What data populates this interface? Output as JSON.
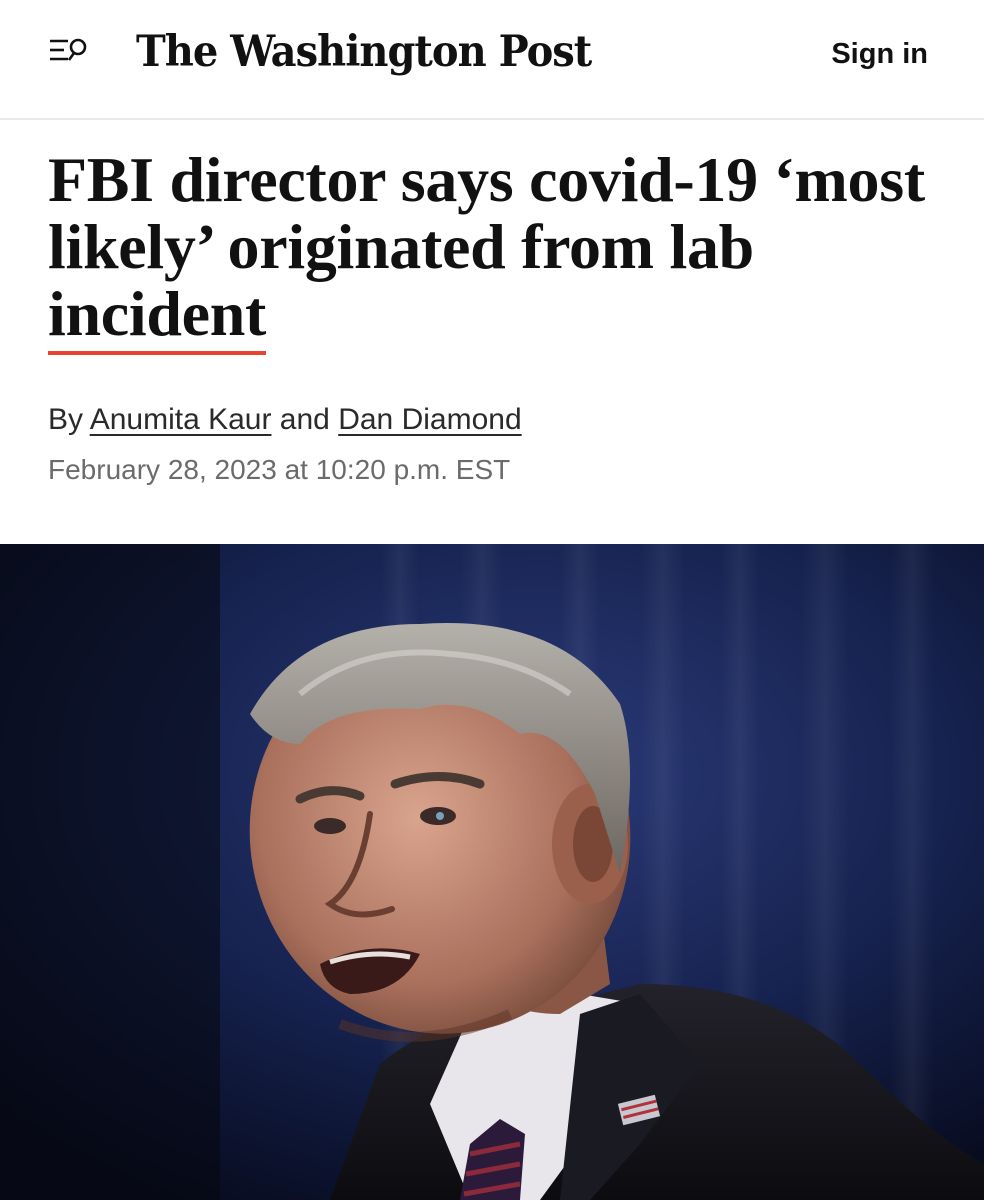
{
  "header": {
    "menu_icon": "menu-search-icon",
    "masthead": "The Washington Post",
    "signin_label": "Sign in"
  },
  "article": {
    "headline_part1": "FBI director says covid-19 ‘most likely’ originated from lab ",
    "headline_part2": "incident",
    "byline_prefix": "By ",
    "author1": "Anumita Kaur",
    "byline_joiner": " and ",
    "author2": "Dan Diamond",
    "timestamp": "February 28, 2023 at 10:20 p.m. EST"
  },
  "colors": {
    "accent_underline": "#e8442f",
    "text": "#111111",
    "meta_text": "#6b6b6b",
    "photo_background": "#0c1430"
  }
}
